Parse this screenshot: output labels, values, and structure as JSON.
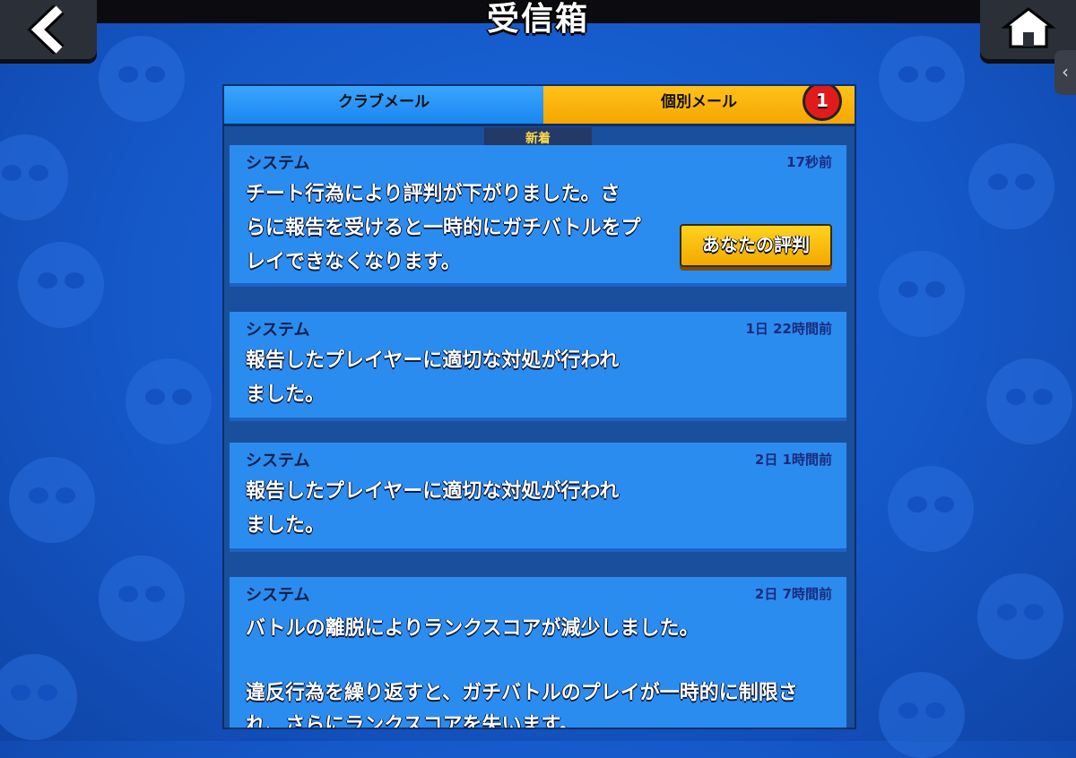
{
  "header": {
    "title": "受信箱"
  },
  "tabs": [
    {
      "label": "クラブメール"
    },
    {
      "label": "個別メール",
      "badge": "1"
    }
  ],
  "section_label": "新着",
  "messages": [
    {
      "sender": "システム",
      "time": "17秒前",
      "body": "チート行為により評判が下がりました。さ\nらに報告を受けると一時的にガチバトルをプ\nレイできなくなります。",
      "button_label": "あなたの評判"
    },
    {
      "sender": "システム",
      "time": "1日 22時間前",
      "body": "報告したプレイヤーに適切な対処が行われ\nました。"
    },
    {
      "sender": "システム",
      "time": "2日 1時間前",
      "body": "報告したプレイヤーに適切な対処が行われ\nました。"
    },
    {
      "sender": "システム",
      "time": "2日 7時間前",
      "body": "バトルの離脱によりランクスコアが減少しました。\n\n違反行為を繰り返すと、ガチバトルのプレイが一時的に制限さ\nれ、さらにランクスコアを失います。"
    }
  ],
  "icons": {
    "back": "chevron-left-icon",
    "home": "home-icon",
    "side": "chevron-left-small-icon"
  },
  "colors": {
    "tab_club": "#1a86f0",
    "tab_personal": "#f5a600",
    "badge": "#e11b1b",
    "card": "#2b8cf0"
  }
}
